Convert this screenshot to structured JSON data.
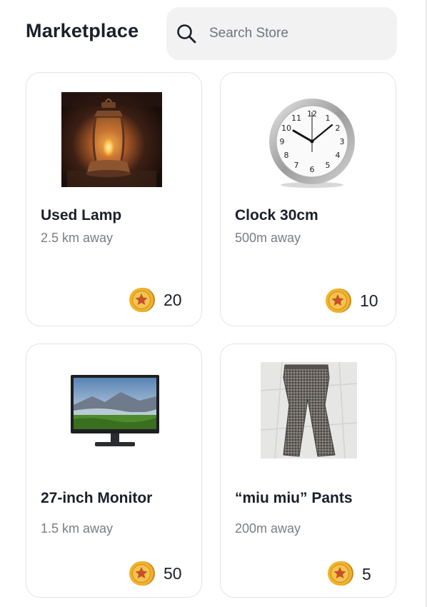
{
  "header": {
    "title": "Marketplace"
  },
  "search": {
    "placeholder": "Search Store",
    "icon": "search-icon"
  },
  "items": [
    {
      "name": "Used Lamp",
      "distance": "2.5 km away",
      "price": "20",
      "image": "lantern-image"
    },
    {
      "name": "Clock 30cm",
      "distance": "500m away",
      "price": "10",
      "image": "clock-image"
    },
    {
      "name": "27-inch Monitor",
      "distance": "1.5 km away",
      "price": "50",
      "image": "monitor-image"
    },
    {
      "name": "“miu miu” Pants",
      "distance": "200m away",
      "price": "5",
      "image": "pants-image"
    }
  ],
  "colors": {
    "coin": "#f0b22c",
    "coin_star": "#c4522a",
    "card_border": "#e3e3e7"
  }
}
